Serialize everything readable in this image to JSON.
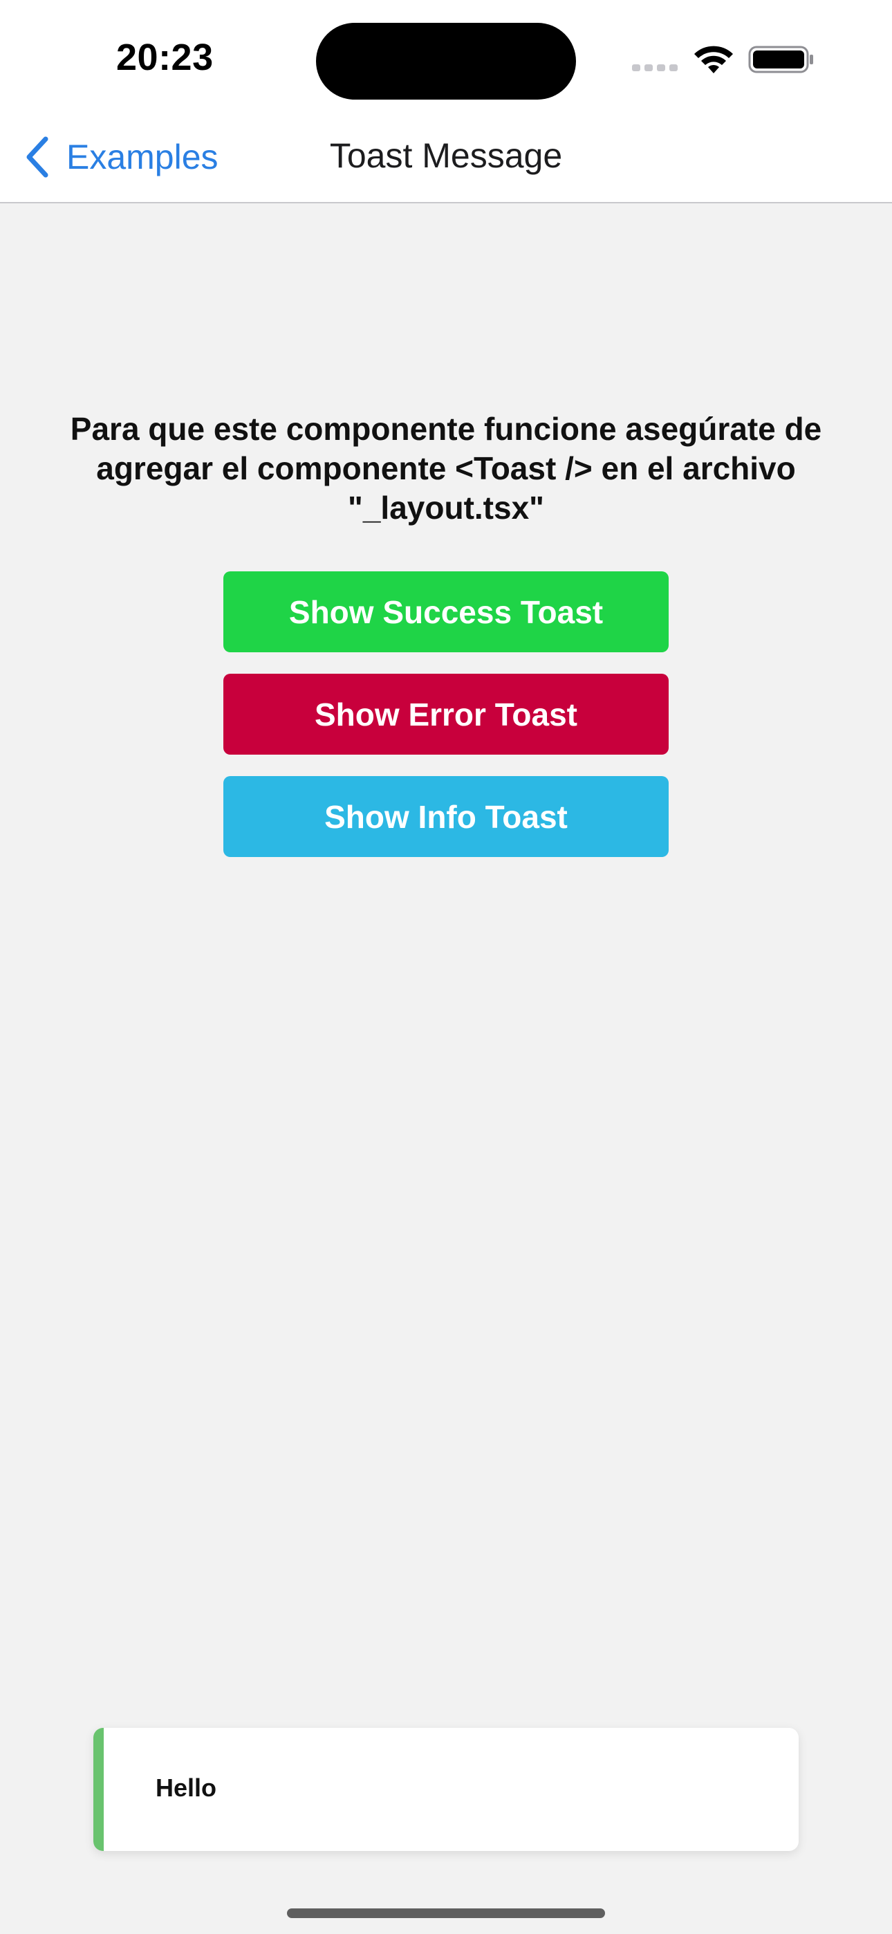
{
  "status_bar": {
    "time": "20:23"
  },
  "nav": {
    "back_label": "Examples",
    "title": "Toast Message"
  },
  "main": {
    "note": "Para que este componente funcione asegúrate de agregar el componente <Toast /> en el archivo \"_layout.tsx\"",
    "buttons": {
      "success": "Show Success Toast",
      "error": "Show Error Toast",
      "info": "Show Info Toast"
    }
  },
  "toast": {
    "message": "Hello"
  },
  "colors": {
    "success": "#1fd447",
    "error": "#c8003c",
    "info": "#2cb8e4",
    "link": "#2a7fe3",
    "toast_accent": "#69c36e",
    "background": "#f2f2f2"
  },
  "icons": {
    "back": "chevron-left-icon",
    "wifi": "wifi-icon",
    "battery": "battery-icon",
    "signal": "cellular-signal-icon"
  }
}
